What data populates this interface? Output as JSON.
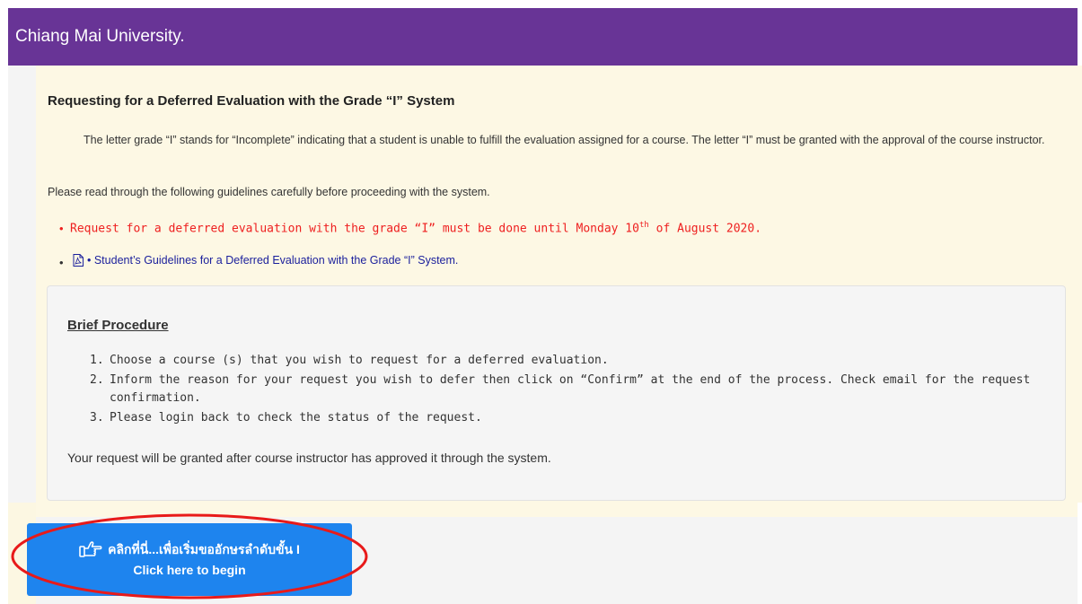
{
  "header": {
    "title": "Chiang Mai University."
  },
  "content": {
    "heading": "Requesting for a Deferred Evaluation with the Grade “I” System",
    "intro": "The letter grade “I” stands for “Incomplete” indicating that a student is unable to fulfill the evaluation assigned for a course. The letter “I” must be granted with the approval of the course instructor.",
    "guide": "Please read through the following guidelines carefully before proceeding with the system.",
    "notice_prefix": "Request for a deferred evaluation with the grade “I” must be done until Monday 10",
    "notice_sup": "th",
    "notice_suffix": " of August 2020.",
    "pdf_link": "• Student’s Guidelines for a Deferred Evaluation with the Grade “I” System."
  },
  "procedure": {
    "title": "Brief Procedure",
    "steps": [
      {
        "num": "1.",
        "text": "Choose a course (s) that you wish to request for a deferred evaluation."
      },
      {
        "num": "2.",
        "text": "Inform the reason for your request you wish to defer then click on “Confirm” at the end of the process. Check email for the request confirmation."
      },
      {
        "num": "3.",
        "text": "Please login back to check the status of the request."
      }
    ],
    "granted": "Your request will be granted after course instructor has approved it through the system."
  },
  "begin_button": {
    "line1": "คลิกที่นี่...เพื่อเริ่มขออักษรลำดับขั้น I",
    "line2": "Click here to begin"
  },
  "colors": {
    "header_bg": "#683496",
    "panel_bg": "#fdf8e4",
    "notice": "#ee1f1f",
    "link": "#1a1f9c",
    "button_bg": "#1e84ee",
    "annotation": "#e81a1a"
  }
}
